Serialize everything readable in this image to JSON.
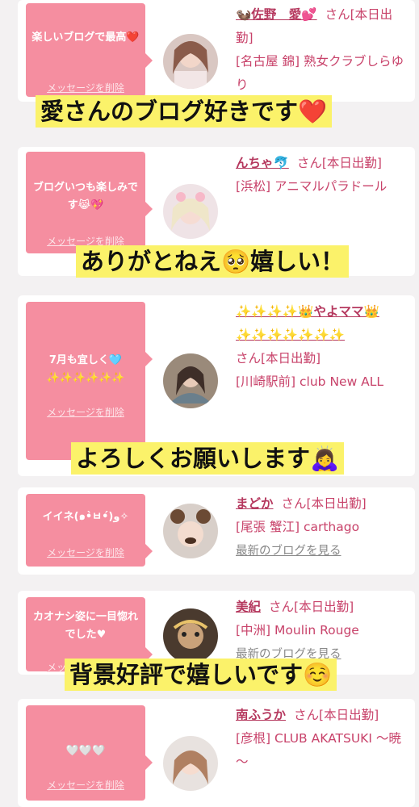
{
  "cards": [
    {
      "message": "楽しいブログで最高❤️",
      "delete_label": "メッセージを削除",
      "name": "🦦佐野　愛💕",
      "suffix": "さん[本日出勤]",
      "area": "[名古屋 錦] 熟女クラブしらゆり",
      "extra": ""
    },
    {
      "message": "ブログいつも楽しみです😹💖",
      "delete_label": "メッセージを削除",
      "name": "んちゃ🐬",
      "suffix": "さん[本日出勤]",
      "area": "[浜松] アニマルパラドール",
      "extra": ""
    },
    {
      "message": "7月も宜しく🩵\n✨✨✨✨✨✨",
      "delete_label": "メッセージを削除",
      "name": "✨✨✨✨👑やよママ👑✨✨✨✨✨✨✨",
      "suffix": "さん[本日出勤]",
      "area": "[川崎駅前] club New ALL",
      "extra": ""
    },
    {
      "message": "イイネ(๑•̀ㅂ•́)و✧",
      "delete_label": "メッセージを削除",
      "name": "まどか",
      "suffix": "さん[本日出勤]",
      "area": "[尾張 蟹江] carthago",
      "extra": "最新のブログを見る"
    },
    {
      "message": "カオナシ姿に一目惚れでした♥",
      "delete_label": "メッセージを削除",
      "name": "美紀",
      "suffix": "さん[本日出勤]",
      "area": "[中洲] Moulin Rouge",
      "extra": "最新のブログを見る"
    },
    {
      "message": "🤍🤍🤍",
      "delete_label": "メッセージを削除",
      "name": "南ふうか",
      "suffix": "さん[本日出勤]",
      "area": "[彦根] CLUB AKATSUKI ～暁～",
      "extra": ""
    }
  ],
  "captions": [
    "愛さんのブログ好きです❤️",
    "ありがとねえ🥺嬉しい！",
    "よろしくお願いします🙇‍♀️",
    "背景好評で嬉しいです☺️"
  ],
  "colors": {
    "bubble": "#f58ea0",
    "name": "#b5385e",
    "caption_bg": "#fbf26a"
  }
}
